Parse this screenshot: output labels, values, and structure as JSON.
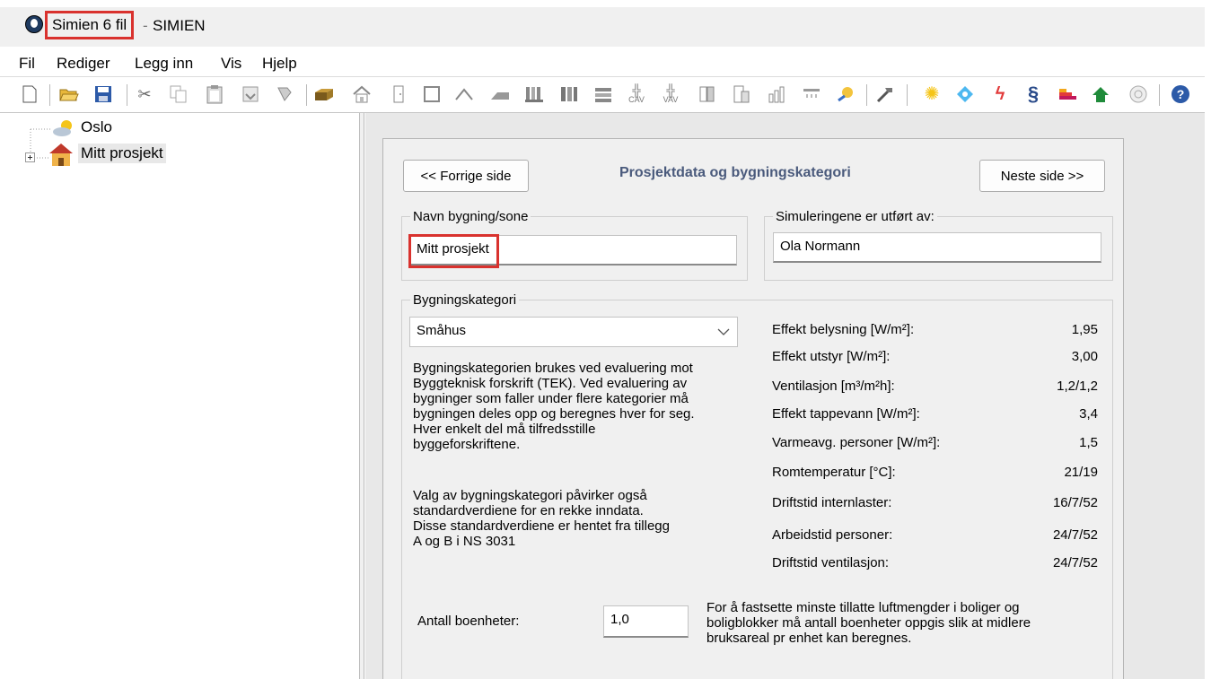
{
  "window": {
    "file_title": "Simien 6 fil",
    "separator": "-",
    "app_name": "SIMIEN"
  },
  "menu": [
    "Fil",
    "Rediger",
    "Legg inn",
    "Vis",
    "Hjelp"
  ],
  "toolbar": {
    "icons": [
      "new-document-icon",
      "open-folder-icon",
      "save-icon",
      "cut-icon",
      "copy-icon",
      "paste-icon",
      "import-icon",
      "export-icon",
      "wall-icon",
      "house-icon",
      "door-icon",
      "window-icon",
      "roof-icon",
      "floor-icon",
      "wall-layer-icon",
      "wall-layer-2-icon",
      "slab-icon",
      "cav-icon",
      "vav-icon",
      "zone-icon",
      "zone-2-icon",
      "chart-icon",
      "heat-icon",
      "lamp-icon",
      "tools-icon",
      "sun-icon",
      "cooling-icon",
      "lightning-icon",
      "paragraph-icon",
      "energy-bar-icon",
      "green-house-icon",
      "target-icon",
      "help-icon"
    ],
    "labels": {
      "cav": "CAV",
      "vav": "VAV",
      "paragraph": "§"
    }
  },
  "tree": {
    "items": [
      {
        "label": "Oslo"
      },
      {
        "label": "Mitt prosjekt"
      }
    ]
  },
  "panel": {
    "prev_button": "<< Forrige side",
    "next_button": "Neste side >>",
    "title": "Prosjektdata og bygningskategori",
    "name_group_label": "Navn bygning/sone",
    "name_value": "Mitt prosjekt",
    "author_group_label": "Simuleringene er utført av:",
    "author_value": "Ola Normann",
    "category_group_label": "Bygningskategori",
    "category_selected": "Småhus",
    "description_1": [
      "Bygningskategorien brukes ved evaluering mot",
      "Byggteknisk forskrift (TEK). Ved evaluering av",
      "bygninger som faller under flere kategorier må",
      "bygningen deles opp og beregnes hver for seg.",
      "Hver enkelt del må tilfredsstille",
      "byggeforskriftene."
    ],
    "description_2": [
      "Valg av bygningskategori påvirker også",
      "standardverdiene for en rekke inndata.",
      "Disse standardverdiene er hentet fra tillegg",
      "A og B i NS 3031"
    ],
    "properties": [
      {
        "label": "Effekt belysning [W/m²]:",
        "value": "1,95"
      },
      {
        "label": "Effekt utstyr [W/m²]:",
        "value": "3,00"
      },
      {
        "label": "Ventilasjon [m³/m²h]:",
        "value": "1,2/1,2"
      },
      {
        "label": "Effekt tappevann [W/m²]:",
        "value": "3,4"
      },
      {
        "label": "Varmeavg. personer [W/m²]:",
        "value": "1,5"
      },
      {
        "label": "Romtemperatur [°C]:",
        "value": "21/19"
      },
      {
        "label": "Driftstid internlaster:",
        "value": "16/7/52"
      },
      {
        "label": "Arbeidstid personer:",
        "value": "24/7/52"
      },
      {
        "label": "Driftstid ventilasjon:",
        "value": "24/7/52"
      }
    ],
    "units_label": "Antall boenheter:",
    "units_value": "1,0",
    "units_note": [
      "For å fastsette minste tillatte luftmengder i boliger  og",
      "boligblokker må antall boenheter oppgis slik at midlere",
      "bruksareal pr enhet kan beregnes."
    ]
  },
  "colors": {
    "highlight": "#d9322e",
    "title": "#4a5a7c"
  }
}
